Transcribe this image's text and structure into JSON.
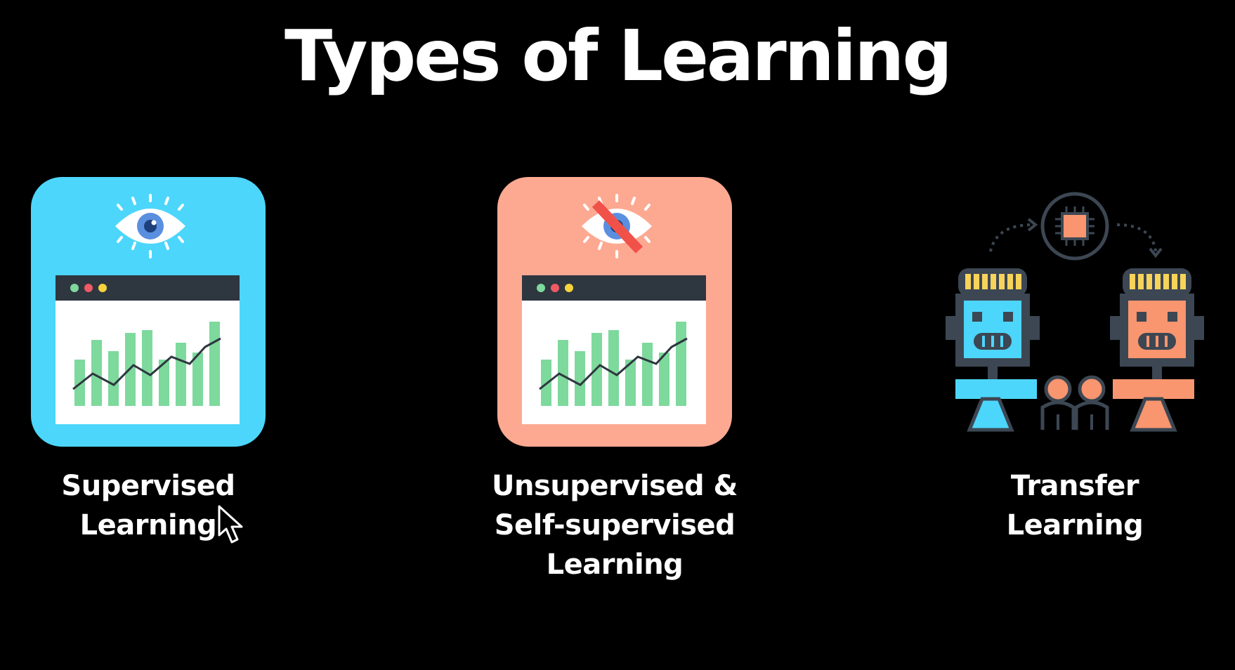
{
  "slide": {
    "title": "Types of Learning"
  },
  "cards": [
    {
      "id": "supervised",
      "label_lines": [
        "Supervised",
        "Learning"
      ],
      "color": "#4dd6fb"
    },
    {
      "id": "unsupervised",
      "label_lines": [
        "Unsupervised &",
        "Self-supervised",
        "Learning"
      ],
      "color": "#fda992"
    },
    {
      "id": "transfer",
      "label_lines": [
        "Transfer",
        "Learning"
      ],
      "color_left": "#4dd6fb",
      "color_right": "#f9956f"
    }
  ],
  "icons": {
    "supervised": [
      "eye-icon",
      "browser-chart-icon"
    ],
    "unsupervised": [
      "crossed-eye-icon",
      "browser-chart-icon"
    ],
    "transfer": [
      "chip-icon",
      "robot-icon",
      "robot-icon",
      "people-icon"
    ]
  },
  "colors": {
    "background": "#000000",
    "text": "#ffffff",
    "bars": "#7dd99c",
    "window_bar": "#2e3640"
  }
}
